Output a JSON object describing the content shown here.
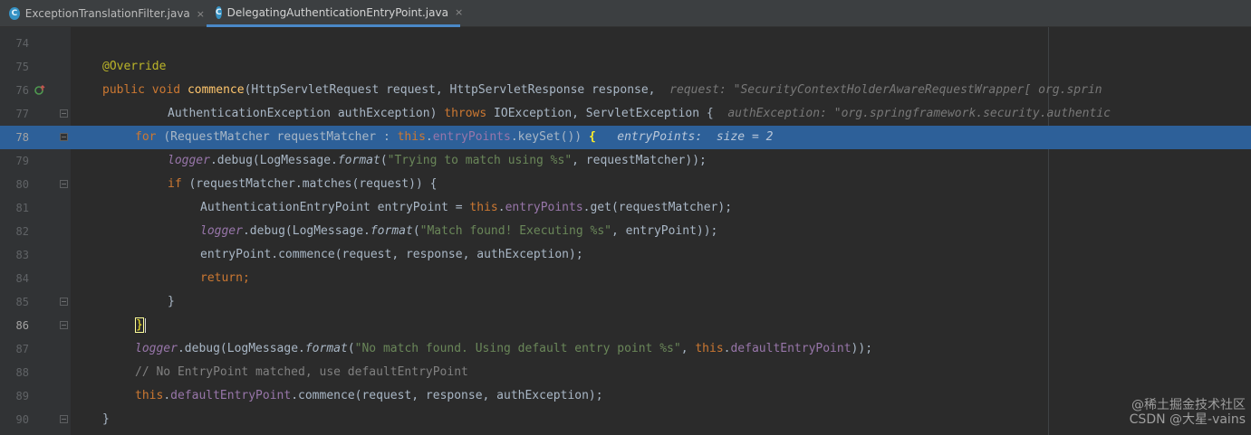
{
  "tabs": [
    {
      "icon": "C",
      "label": "ExceptionTranslationFilter.java",
      "close": "×"
    },
    {
      "icon": "C",
      "label": "DelegatingAuthenticationEntryPoint.java",
      "close": "×"
    }
  ],
  "lines": {
    "n74": "74",
    "n75": "75",
    "n76": "76",
    "n77": "77",
    "n78": "78",
    "n79": "79",
    "n80": "80",
    "n81": "81",
    "n82": "82",
    "n83": "83",
    "n84": "84",
    "n85": "85",
    "n86": "86",
    "n87": "87",
    "n88": "88",
    "n89": "89",
    "n90": "90"
  },
  "code": {
    "l75_annotation": "@Override",
    "l76_public": "public",
    "l76_void": "void",
    "l76_method": "commence",
    "l76_params": "(HttpServletRequest request, HttpServletResponse response,",
    "l76_hint": "request: \"SecurityContextHolderAwareRequestWrapper[ org.sprin",
    "l77_params": "AuthenticationException authException)",
    "l77_throws": "throws",
    "l77_exceptions": "IOException, ServletException {",
    "l77_hint": "authException: \"org.springframework.security.authentic",
    "l78_for": "for",
    "l78_decl": "(RequestMatcher requestMatcher :",
    "l78_this": "this",
    "l78_field": "entryPoints",
    "l78_rest": ".keySet())",
    "l78_brace": "{",
    "l78_hint": "entryPoints:  size = 2",
    "l79_logger": "logger",
    "l79_debug": ".debug(LogMessage.",
    "l79_format": "format",
    "l79_str": "\"Trying to match using %s\"",
    "l79_rest": ", requestMatcher));",
    "l80_if": "if",
    "l80_rest": "(requestMatcher.matches(request)) {",
    "l81_decl": "AuthenticationEntryPoint entryPoint =",
    "l81_this": "this",
    "l81_field": "entryPoints",
    "l81_rest": ".get(requestMatcher);",
    "l82_logger": "logger",
    "l82_debug": ".debug(LogMessage.",
    "l82_format": "format",
    "l82_str": "\"Match found! Executing %s\"",
    "l82_rest": ", entryPoint));",
    "l83_code": "entryPoint.commence(request, response, authException);",
    "l84_return": "return",
    "l84_semi": ";",
    "l85_brace": "}",
    "l86_brace": "}",
    "l87_logger": "logger",
    "l87_debug": ".debug(LogMessage.",
    "l87_format": "format",
    "l87_str": "\"No match found. Using default entry point %s\"",
    "l87_this": "this",
    "l87_field": "defaultEntryPoint",
    "l87_rest": "));",
    "l88_comment": "// No EntryPoint matched, use defaultEntryPoint",
    "l89_this": "this",
    "l89_field": "defaultEntryPoint",
    "l89_rest": ".commence(request, response, authException);",
    "l90_brace": "}"
  },
  "watermark": {
    "line1": "@稀土掘金技术社区",
    "line2": "CSDN @大星-vains"
  },
  "colors": {
    "background": "#2b2b2b",
    "gutter": "#313335",
    "current_line": "#2d6099",
    "keyword": "#cc7832",
    "annotation": "#bbb529",
    "method": "#ffc66d",
    "field": "#9876aa",
    "string": "#6a8759",
    "comment": "#808080"
  }
}
